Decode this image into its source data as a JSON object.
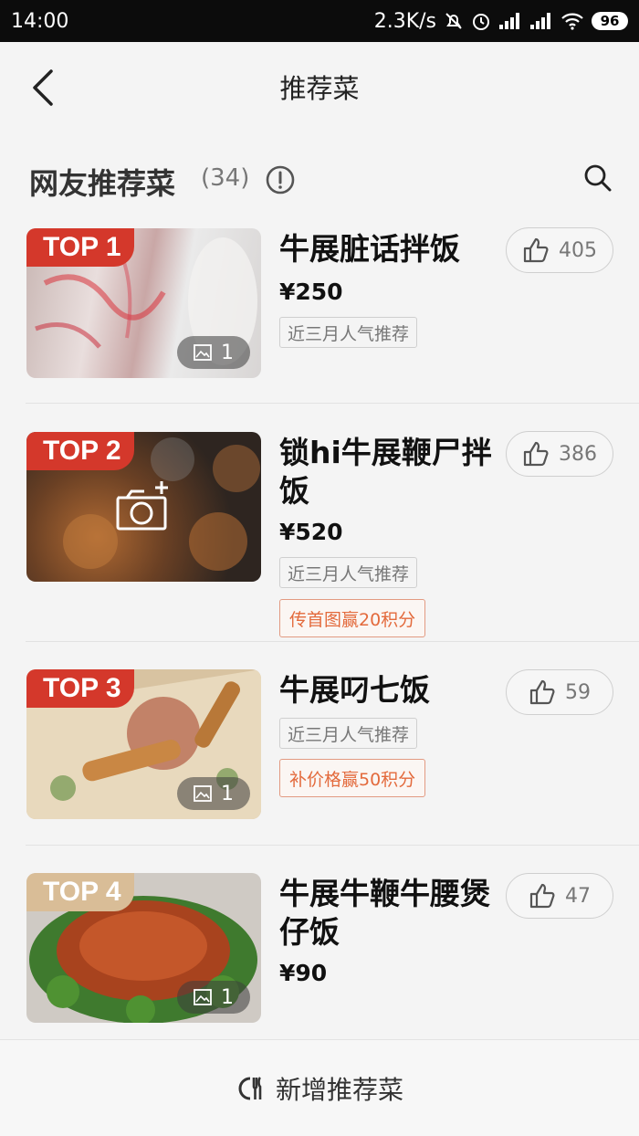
{
  "status_bar": {
    "time": "14:00",
    "net_speed": "2.3K/s",
    "battery": "96"
  },
  "header": {
    "title": "推荐菜",
    "back_icon": "chevron-left-icon"
  },
  "section": {
    "title": "网友推荐菜",
    "count": "(34)",
    "info_icon": "info-circle-icon",
    "search_icon": "search-icon"
  },
  "dishes": [
    {
      "rank": "TOP 1",
      "name": "牛展脏话拌饭",
      "price": "¥250",
      "tag": "近三月人气推荐",
      "task": "",
      "likes": "405",
      "photo_count": "1"
    },
    {
      "rank": "TOP 2",
      "name": "锁hi牛展鞭尸拌饭",
      "price": "¥520",
      "tag": "近三月人气推荐",
      "task": "传首图赢20积分",
      "likes": "386",
      "photo_count": ""
    },
    {
      "rank": "TOP 3",
      "name": "牛展叼七饭",
      "price": "",
      "tag": "近三月人气推荐",
      "task": "补价格赢50积分",
      "likes": "59",
      "photo_count": "1"
    },
    {
      "rank": "TOP 4",
      "name": "牛展牛鞭牛腰煲仔饭",
      "price": "¥90",
      "tag": "",
      "task": "",
      "likes": "47",
      "photo_count": "1"
    }
  ],
  "bottom": {
    "label": "新增推荐菜",
    "icon": "plate-utensils-icon"
  },
  "colors": {
    "rank_red": "#d4382b",
    "rank_beige": "#d9bd97",
    "task_orange": "#e36a3c"
  }
}
